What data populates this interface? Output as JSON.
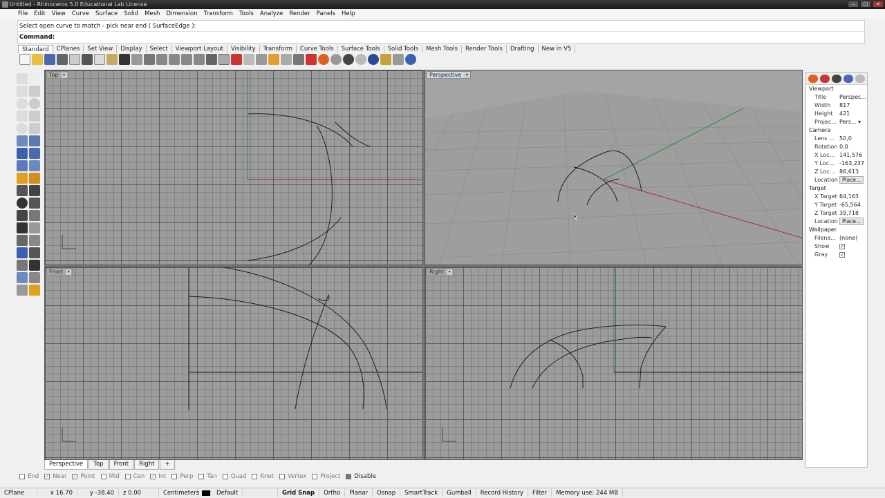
{
  "window": {
    "title": "Untitled - Rhinoceros 5.0 Educational Lab License"
  },
  "menu": [
    "File",
    "Edit",
    "View",
    "Curve",
    "Surface",
    "Solid",
    "Mesh",
    "Dimension",
    "Transform",
    "Tools",
    "Analyze",
    "Render",
    "Panels",
    "Help"
  ],
  "command": {
    "history": "Select open curve to match - pick near end ( SurfaceEdge ):",
    "prompt": "Command:"
  },
  "toolbar_tabs": [
    "Standard",
    "CPlanes",
    "Set View",
    "Display",
    "Select",
    "Viewport Layout",
    "Visibility",
    "Transform",
    "Curve Tools",
    "Surface Tools",
    "Solid Tools",
    "Mesh Tools",
    "Render Tools",
    "Drafting",
    "New in V5"
  ],
  "viewports": {
    "top": "Top",
    "perspective": "Perspective",
    "front": "Front",
    "right": "Right"
  },
  "viewport_tabs": [
    "Perspective",
    "Top",
    "Front",
    "Right"
  ],
  "viewport_tabs_add": "+",
  "properties": {
    "viewport_header": "Viewport",
    "title_k": "Title",
    "title_v": "Perspec...",
    "width_k": "Width",
    "width_v": "817",
    "height_k": "Height",
    "height_v": "421",
    "proj_k": "Projec...",
    "proj_v": "Pers...",
    "camera_header": "Camera",
    "lens_k": "Lens ...",
    "lens_v": "50,0",
    "rot_k": "Rotation",
    "rot_v": "0,0",
    "xloc_k": "X Loc...",
    "xloc_v": "141,576",
    "yloc_k": "Y Loc...",
    "yloc_v": "-163,237",
    "zloc_k": "Z Loc...",
    "zloc_v": "86,613",
    "loc_k": "Location",
    "loc_btn": "Place...",
    "target_header": "Target",
    "xt_k": "X Target",
    "xt_v": "64,163",
    "yt_k": "Y Target",
    "yt_v": "-65,564",
    "zt_k": "Z Target",
    "zt_v": "39,718",
    "tloc_k": "Location",
    "tloc_btn": "Place...",
    "wall_header": "Wallpaper",
    "file_k": "Filena...",
    "file_v": "(none)",
    "show_k": "Show",
    "gray_k": "Gray",
    "check": "✓"
  },
  "osnap": {
    "end": "End",
    "near": "Near",
    "point": "Point",
    "mid": "Mid",
    "cen": "Cen",
    "int": "Int",
    "perp": "Perp",
    "tan": "Tan",
    "quad": "Quad",
    "knot": "Knot",
    "vertex": "Vertex",
    "project": "Project",
    "disable": "Disable",
    "check": "✓"
  },
  "status": {
    "cplane": "CPlane",
    "x": "x 16.70",
    "y": "y -38.40",
    "z": "z 0.00",
    "units": "Centimeters",
    "layer": "Default",
    "grid_snap": "Grid Snap",
    "ortho": "Ortho",
    "planar": "Planar",
    "osnap": "Osnap",
    "smarttrack": "SmartTrack",
    "gumball": "Gumball",
    "record": "Record History",
    "filter": "Filter",
    "memory": "Memory use: 244 MB"
  },
  "colors": {
    "x_axis": "#b03030",
    "y_axis": "#2f8a3a",
    "curve": "#1e1e1e",
    "grid_bg": "#9c9c9c"
  }
}
